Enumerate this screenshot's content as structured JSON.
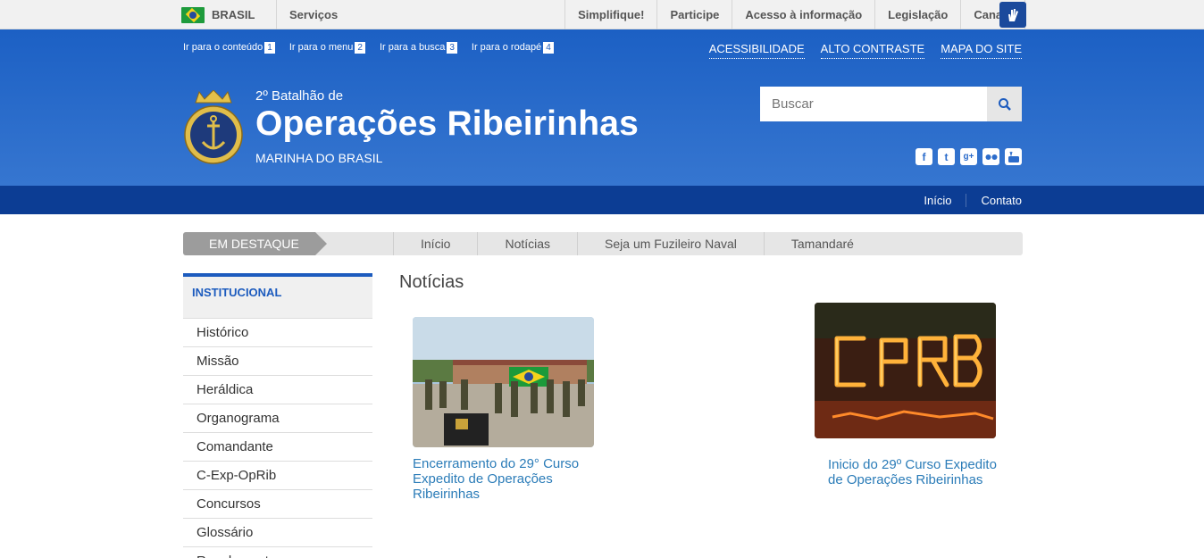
{
  "gov_bar": {
    "country": "BRASIL",
    "services": "Serviços",
    "links": [
      "Simplifique!",
      "Participe",
      "Acesso à informação",
      "Legislação",
      "Canais"
    ]
  },
  "header": {
    "skip_links": [
      {
        "label": "Ir para o conteúdo",
        "num": "1"
      },
      {
        "label": "Ir para o menu",
        "num": "2"
      },
      {
        "label": "Ir para a busca",
        "num": "3"
      },
      {
        "label": "Ir para o rodapé",
        "num": "4"
      }
    ],
    "accessibility_links": [
      "ACESSIBILIDADE",
      "ALTO CONTRASTE",
      "MAPA DO SITE"
    ],
    "pretitle": "2º Batalhão de",
    "title": "Operações Ribeirinhas",
    "subtitle": "MARINHA DO BRASIL",
    "logo_text": "MARINHA DO BRASIL",
    "search_placeholder": "Buscar",
    "social_icons": [
      "facebook-icon",
      "twitter-icon",
      "googleplus-icon",
      "flickr-icon",
      "youtube-icon"
    ]
  },
  "service_bar": {
    "links": [
      "Início",
      "Contato"
    ]
  },
  "featured": {
    "tag": "EM DESTAQUE",
    "items": [
      "Início",
      "Notícias",
      "Seja um Fuzileiro Naval",
      "Tamandaré"
    ]
  },
  "sidebar": {
    "heading": "INSTITUCIONAL",
    "items": [
      "Histórico",
      "Missão",
      "Heráldica",
      "Organograma",
      "Comandante",
      "C-Exp-OpRib",
      "Concursos",
      "Glossário",
      "Regulamentos"
    ]
  },
  "content": {
    "title": "Notícias",
    "news": [
      {
        "caption": "Encerramento do 29° Curso Expedito de Operações Ribeirinhas"
      },
      {
        "caption": "Inicio do 29º Curso Expedito de Operações Ribeirinhas"
      }
    ]
  },
  "colors": {
    "header_blue": "#1c60c4",
    "service_bar_blue": "#0c3d94",
    "link_blue": "#2b7cb8"
  }
}
